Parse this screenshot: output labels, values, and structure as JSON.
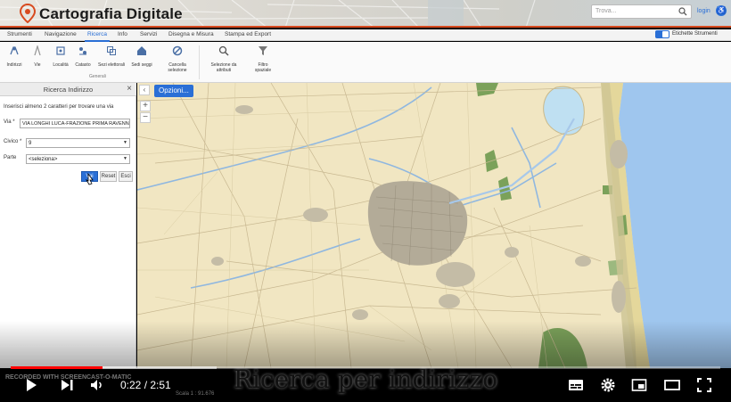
{
  "header": {
    "title": "Cartografia Digitale",
    "search_placeholder": "Trova...",
    "login": "login",
    "accent": "#d84a1f"
  },
  "ribbon": {
    "tabs": [
      "Strumenti",
      "Navigazione",
      "Ricerca",
      "Info",
      "Servizi",
      "Disegna e Misura",
      "Stampa ed Export"
    ],
    "active_tab": "Ricerca",
    "labels_toggle": "Etichette Strumenti",
    "tools": [
      {
        "label": "Indirizzi",
        "icon": "address-icon"
      },
      {
        "label": "Vie",
        "icon": "road-icon"
      },
      {
        "label": "Località",
        "icon": "locality-icon"
      },
      {
        "label": "Catasto",
        "icon": "cadastre-icon"
      },
      {
        "label": "Sezi elettorali",
        "icon": "electoral-icon"
      },
      {
        "label": "Sedi seggi",
        "icon": "polling-icon"
      },
      {
        "label": "Cancella selezione",
        "icon": "cancel-selection-icon"
      },
      {
        "label": "Selezione da attributi",
        "icon": "attribute-search-icon"
      },
      {
        "label": "Filtro spaziale",
        "icon": "filter-icon"
      }
    ],
    "group_label": "Generali"
  },
  "panel": {
    "title": "Ricerca Indirizzo",
    "hint": "Inserisci almeno 2 caratteri per trovare una via",
    "via_label": "Via *",
    "via_value": "VIA LONGHI LUCA-FRAZIONE PRIMA RAVENNA",
    "civico_label": "Civico *",
    "civico_value": "9",
    "parte_label": "Parte",
    "parte_value": "<seleziona>",
    "btn_search": "Vai",
    "btn_reset": "Reset",
    "btn_exit": "Esci"
  },
  "map": {
    "options_label": "Opzioni...",
    "scale_text": "Scala 1 : 91.676",
    "land_color": "#f1e6c2",
    "sea_color": "#9fc6ee",
    "urban_color": "#b3ab98",
    "green_color": "#7ba15a"
  },
  "player": {
    "caption": "Ricerca per indirizzo",
    "time": "0:22 / 2:51",
    "progress": 0.129,
    "buffered": 0.29,
    "watermark": "RECORDED WITH SCREENCAST-O-MATIC"
  }
}
